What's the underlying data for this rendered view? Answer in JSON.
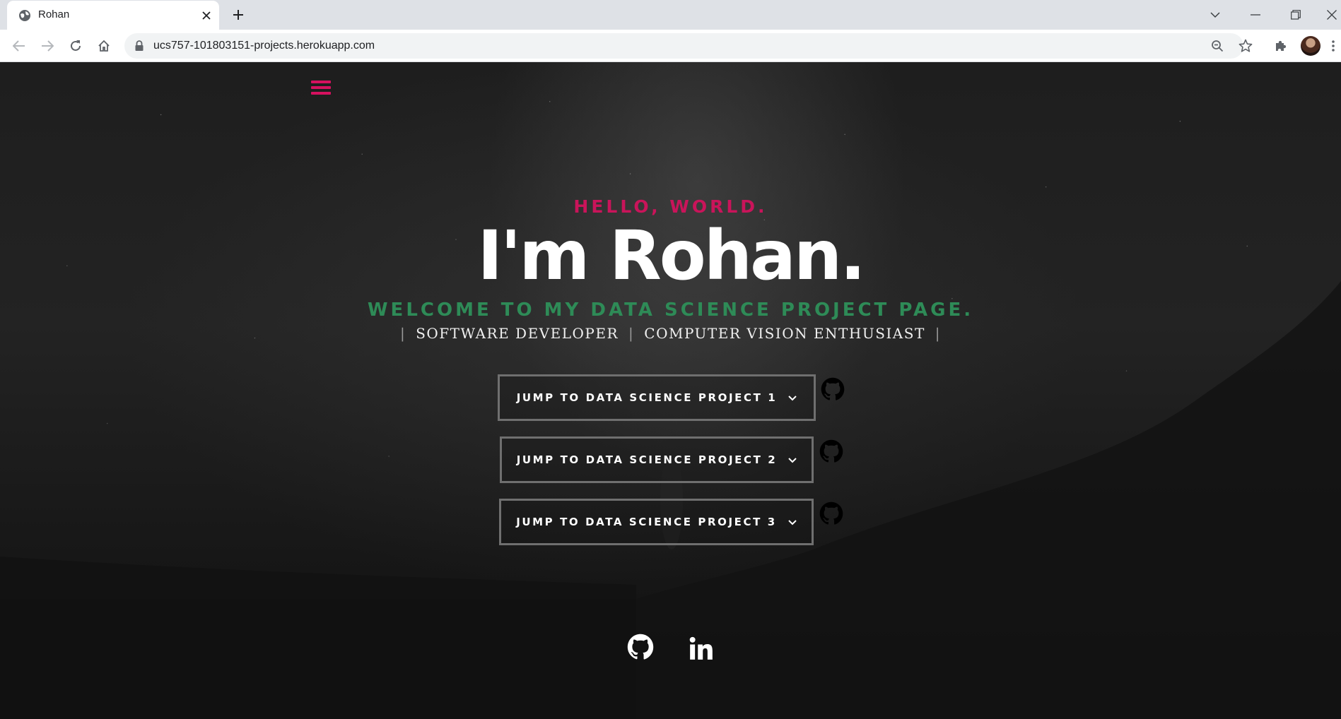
{
  "browser": {
    "tab_title": "Rohan",
    "url": "ucs757-101803151-projects.herokuapp.com"
  },
  "page": {
    "greeting": "HELLO, WORLD.",
    "headline": "I'm Rohan.",
    "welcome": "WELCOME TO MY DATA SCIENCE PROJECT PAGE.",
    "roles": [
      "SOFTWARE DEVELOPER",
      "COMPUTER VISION ENTHUSIAST"
    ],
    "projects": [
      {
        "label": "JUMP TO DATA SCIENCE PROJECT 1"
      },
      {
        "label": "JUMP TO DATA SCIENCE PROJECT 2"
      },
      {
        "label": "JUMP TO DATA SCIENCE PROJECT 3"
      }
    ],
    "social": [
      "github-icon",
      "linkedin-icon"
    ]
  },
  "colors": {
    "greeting": "#c9145a",
    "welcome": "#2e8b57",
    "menu": "#d6115f",
    "background": "#141414"
  }
}
